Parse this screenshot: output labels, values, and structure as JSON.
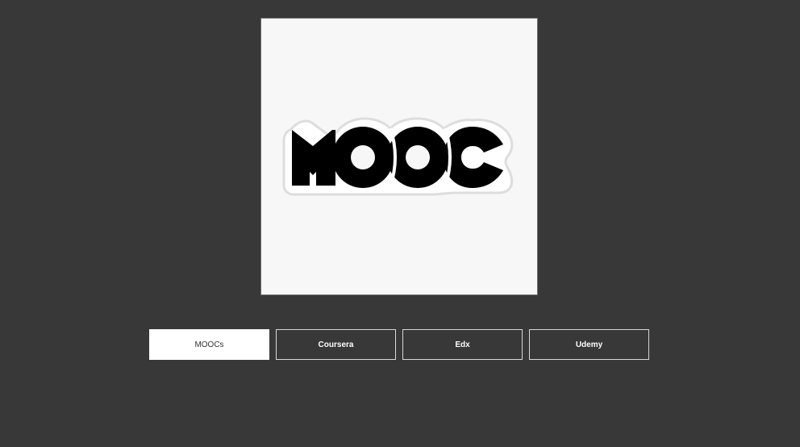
{
  "hero_image": {
    "logo_text": "MOOC",
    "icon": "mooc-logo-sticker"
  },
  "tabs": [
    {
      "label": "MOOCs",
      "active": true
    },
    {
      "label": "Coursera",
      "active": false
    },
    {
      "label": "Edx",
      "active": false
    },
    {
      "label": "Udemy",
      "active": false
    }
  ],
  "colors": {
    "background": "#383838",
    "card": "#f7f7f7",
    "tab_active_bg": "#ffffff",
    "tab_border": "#d8d8d8"
  }
}
